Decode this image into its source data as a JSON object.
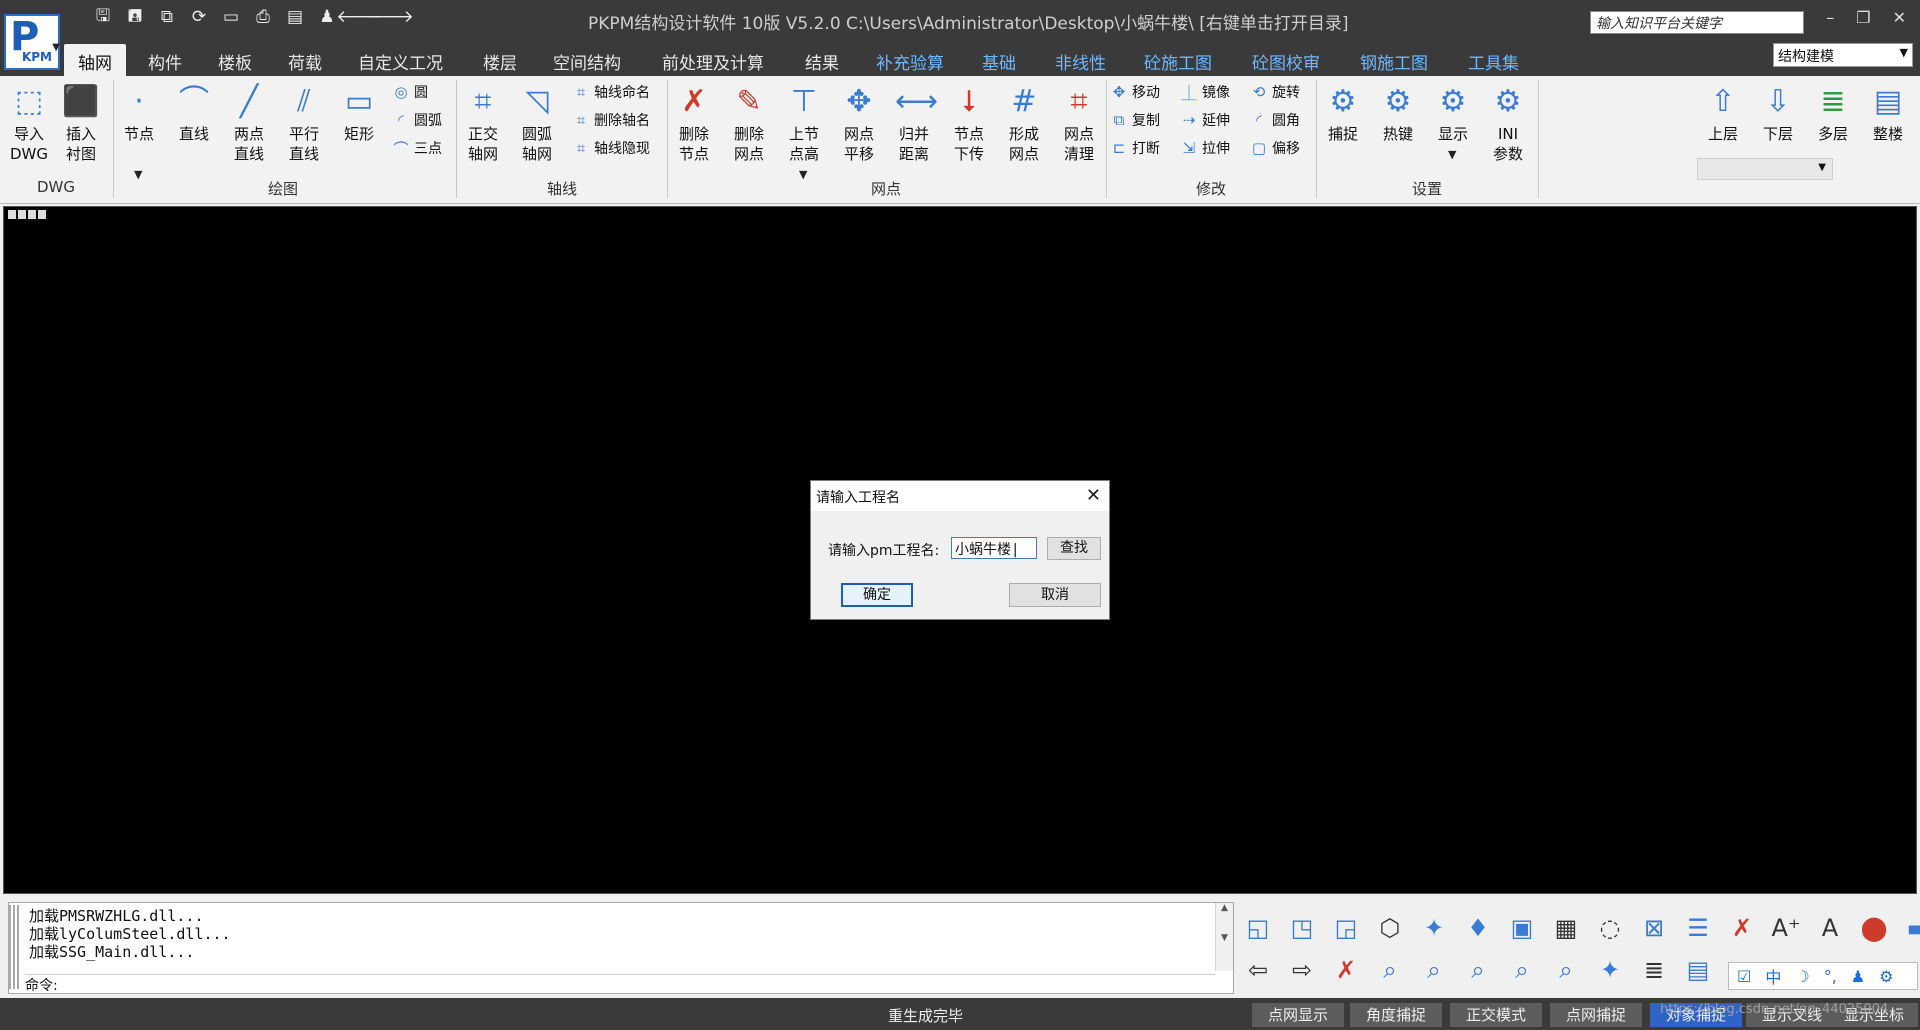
{
  "app": {
    "title": "PKPM结构设计软件 10版 V5.2.0 C:\\Users\\Administrator\\Desktop\\小蜗牛楼\\  [右键单击打开目录]",
    "logo_text": "P",
    "logo_sub": "KPM",
    "search_placeholder": "输入知识平台关键字",
    "mode": "结构建模"
  },
  "tabs": [
    {
      "label": "轴网",
      "active": true
    },
    {
      "label": "构件"
    },
    {
      "label": "楼板"
    },
    {
      "label": "荷载"
    },
    {
      "label": "自定义工况"
    },
    {
      "label": "楼层"
    },
    {
      "label": "空间结构"
    },
    {
      "label": "前处理及计算"
    },
    {
      "label": "结果"
    },
    {
      "label": "补充验算",
      "blue": true
    },
    {
      "label": "基础",
      "blue": true
    },
    {
      "label": "非线性",
      "blue": true
    },
    {
      "label": "砼施工图",
      "blue": true
    },
    {
      "label": "砼图校审",
      "blue": true
    },
    {
      "label": "钢施工图",
      "blue": true
    },
    {
      "label": "工具集",
      "blue": true
    }
  ],
  "ribbon": {
    "dwg": {
      "label": "DWG",
      "import": "导入\nDWG",
      "insert": "插入\n衬图"
    },
    "draw": {
      "label": "绘图",
      "node": "节点",
      "line": "直线",
      "two_point": "两点\n直线",
      "parallel": "平行\n直线",
      "rect": "矩形",
      "circle": "圆",
      "arc": "圆弧",
      "three_point": "三点"
    },
    "axis": {
      "label": "轴线",
      "ortho": "正交\n轴网",
      "arc_grid": "圆弧\n轴网",
      "name": "轴线命名",
      "delete_name": "删除轴名",
      "hide": "轴线隐现"
    },
    "grid": {
      "label": "网点",
      "del_node": "删除\n节点",
      "del_grid": "删除\n网点",
      "node_elev": "上节\n点高",
      "grid_move": "网点\n平移",
      "merge_dist": "归并\n距离",
      "node_down": "节点\n下传",
      "form_grid": "形成\n网点",
      "clean_grid": "网点\n清理"
    },
    "modify": {
      "label": "修改",
      "move": "移动",
      "copy": "复制",
      "break": "打断",
      "mirror": "镜像",
      "extend": "延伸",
      "stretch": "拉伸",
      "rotate": "旋转",
      "fillet": "圆角",
      "offset": "偏移"
    },
    "settings": {
      "label": "设置",
      "snap": "捕捉",
      "hotkey": "热键",
      "display": "显示",
      "ini": "INI\n参数"
    },
    "floor": {
      "up": "上层",
      "down": "下层",
      "multi": "多层",
      "whole": "整楼"
    }
  },
  "dialog": {
    "title": "请输入工程名",
    "prompt": "请输入pm工程名:",
    "value": "小蜗牛楼|",
    "find": "查找",
    "ok": "确定",
    "cancel": "取消"
  },
  "command": {
    "lines": [
      "加载PMSRWZHLG.dll...",
      "加载lyColumSteel.dll...",
      "加载SSG_Main.dll..."
    ],
    "prompt": "命令:"
  },
  "status": {
    "message": "重生成完毕",
    "buttons": [
      {
        "label": "点网显示",
        "on": false
      },
      {
        "label": "角度捕捉",
        "on": false
      },
      {
        "label": "正交模式",
        "on": false
      },
      {
        "label": "点网捕捉",
        "on": false
      },
      {
        "label": "对象捕捉",
        "on": true
      },
      {
        "label": "显示叉线",
        "on": false
      },
      {
        "label": "显示坐标",
        "on": false
      }
    ],
    "watermark": "https://blog.csdn.net/qq_44025004"
  },
  "ime": {
    "lang": "中"
  }
}
